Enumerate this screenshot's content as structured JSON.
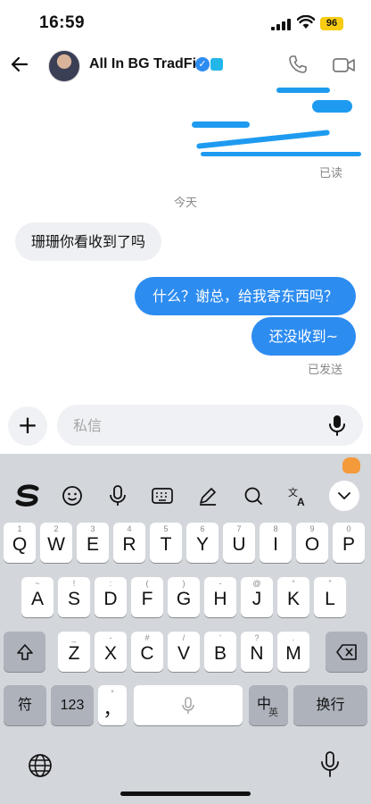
{
  "status": {
    "time": "16:59",
    "battery": "96"
  },
  "header": {
    "title": "All In BG TradFi"
  },
  "chat": {
    "read_label": "已读",
    "day_divider": "今天",
    "messages": [
      {
        "side": "in",
        "text": "珊珊你看收到了吗"
      },
      {
        "side": "out",
        "text": "什么？谢总，给我寄东西吗？"
      },
      {
        "side": "out",
        "text": "还没收到~"
      }
    ],
    "sent_label": "已发送"
  },
  "composer": {
    "placeholder": "私信"
  },
  "keyboard": {
    "toolbar": [
      "sogou-logo-icon",
      "emoji-icon",
      "voice-icon",
      "keyboard-icon",
      "handwriting-icon",
      "search-icon",
      "translate-icon",
      "collapse-icon"
    ],
    "row1": [
      {
        "k": "Q",
        "s": "1"
      },
      {
        "k": "W",
        "s": "2"
      },
      {
        "k": "E",
        "s": "3"
      },
      {
        "k": "R",
        "s": "4"
      },
      {
        "k": "T",
        "s": "5"
      },
      {
        "k": "Y",
        "s": "6"
      },
      {
        "k": "U",
        "s": "7"
      },
      {
        "k": "I",
        "s": "8"
      },
      {
        "k": "O",
        "s": "9"
      },
      {
        "k": "P",
        "s": "0"
      }
    ],
    "row2": [
      {
        "k": "A",
        "s": "~"
      },
      {
        "k": "S",
        "s": "!"
      },
      {
        "k": "D",
        "s": ":"
      },
      {
        "k": "F",
        "s": "("
      },
      {
        "k": "G",
        "s": ")"
      },
      {
        "k": "H",
        "s": "-"
      },
      {
        "k": "J",
        "s": "@"
      },
      {
        "k": "K",
        "s": "“"
      },
      {
        "k": "L",
        "s": "”"
      }
    ],
    "row3": [
      {
        "k": "Z",
        "s": "_"
      },
      {
        "k": "X",
        "s": "-"
      },
      {
        "k": "C",
        "s": "#"
      },
      {
        "k": "V",
        "s": "/"
      },
      {
        "k": "B",
        "s": "'"
      },
      {
        "k": "N",
        "s": "?"
      },
      {
        "k": "M",
        "s": "."
      }
    ],
    "symbols_label": "符",
    "numbers_label": "123",
    "comma_label": "，",
    "lang_main": "中",
    "lang_sub": "英",
    "return_label": "换行"
  }
}
